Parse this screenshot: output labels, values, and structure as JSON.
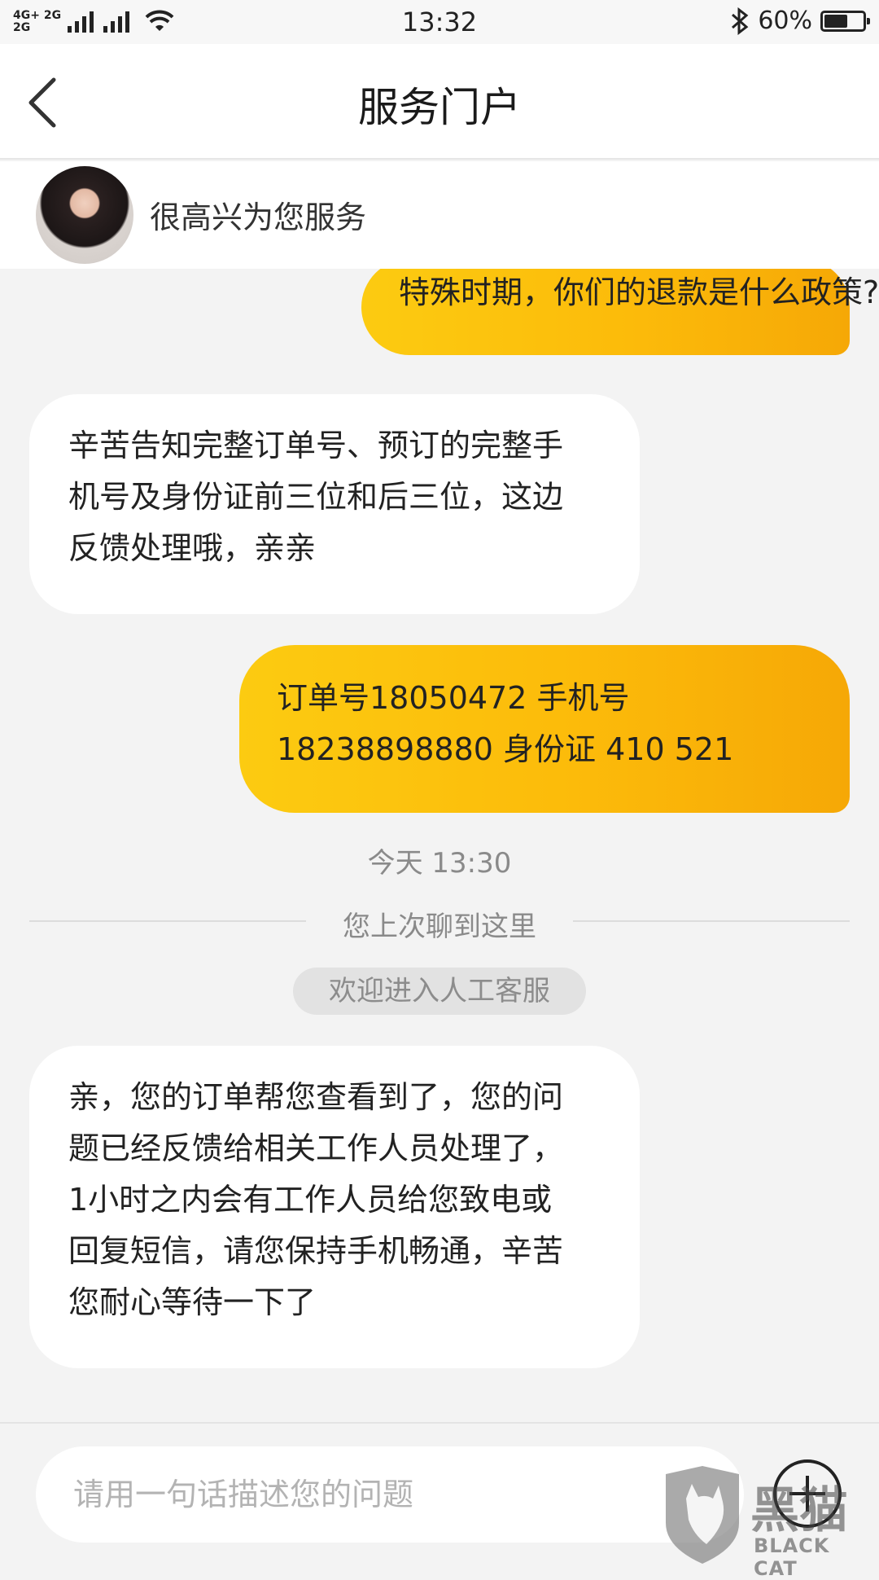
{
  "status_bar": {
    "network_top": "4G+ 2G",
    "network_bottom": "2G",
    "time": "13:32",
    "battery_text": "60%",
    "battery_level": 0.6,
    "icons": [
      "signal-icon",
      "wifi-icon",
      "bluetooth-icon",
      "battery-icon"
    ]
  },
  "header": {
    "title": "服务门户"
  },
  "agent": {
    "greeting": "很高兴为您服务"
  },
  "messages": [
    {
      "direction": "out",
      "lines": [
        "特殊时期，你们的退款是什么政策?"
      ]
    },
    {
      "direction": "in",
      "lines": [
        "辛苦告知完整订单号、预订的完整手",
        "机号及身份证前三位和后三位，这边",
        "反馈处理哦，亲亲"
      ]
    },
    {
      "direction": "out",
      "lines": [
        "订单号18050472 手机号",
        "18238898880 身份证 410 521"
      ]
    },
    {
      "direction": "in",
      "lines": [
        "亲，您的订单帮您查看到了，您的问",
        "题已经反馈给相关工作人员处理了，",
        "1小时之内会有工作人员给您致电或",
        "回复短信，请您保持手机畅通，辛苦",
        "您耐心等待一下了"
      ]
    }
  ],
  "system": {
    "timestamp": "今天 13:30",
    "last_chat_divider": "您上次聊到这里",
    "welcome_notice": "欢迎进入人工客服"
  },
  "input": {
    "placeholder": "请用一句话描述您的问题"
  },
  "watermark": {
    "text": "黑猫",
    "subtext": "BLACK CAT"
  },
  "colors": {
    "accent_gradient_start": "#fccb11",
    "accent_gradient_end": "#f6a806",
    "background": "#f3f3f3"
  }
}
